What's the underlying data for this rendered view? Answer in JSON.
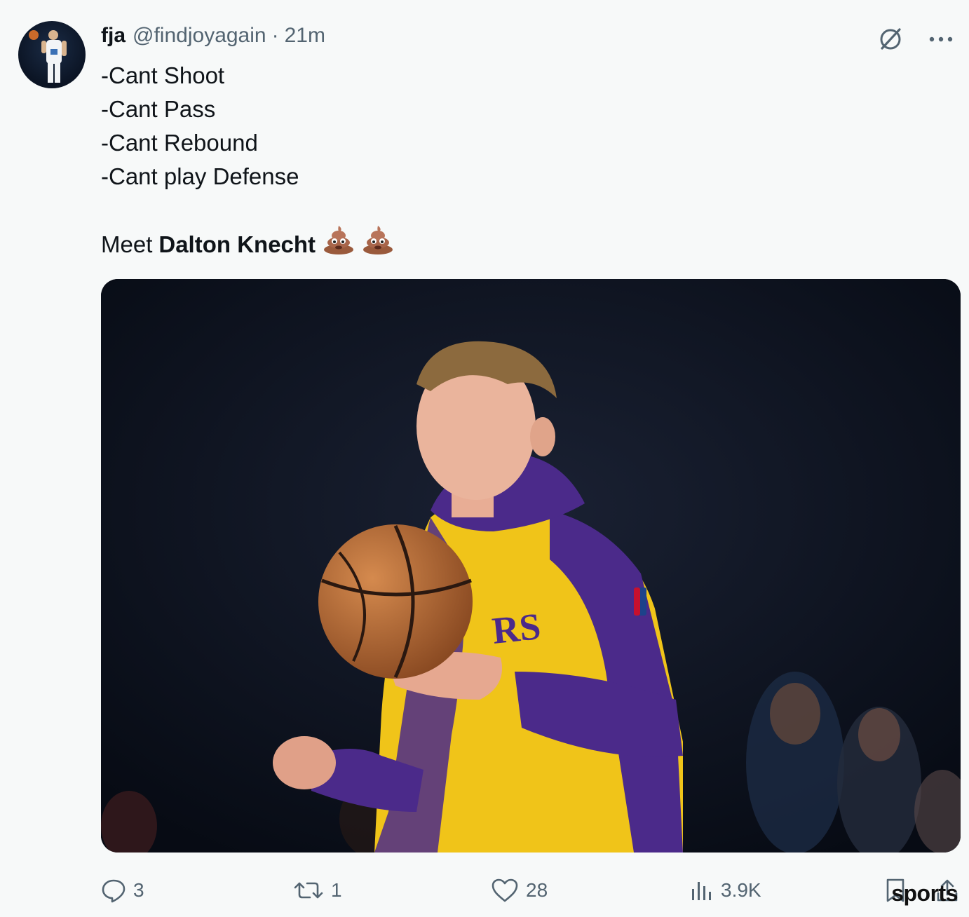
{
  "tweet": {
    "author_name": "fja",
    "handle": "@findjoyagain",
    "separator": "·",
    "time": "21m",
    "lines": [
      "-Cant Shoot",
      "-Cant Pass",
      "-Cant Rebound",
      "-Cant play Defense"
    ],
    "meet_prefix": "Meet",
    "meet_name": "Dalton Knecht",
    "emojis": [
      "pile-of-poo",
      "pile-of-poo"
    ]
  },
  "top_actions": {
    "grok_icon": "slashed-circle-icon",
    "more_icon": "more-icon"
  },
  "actions": {
    "replies": "3",
    "retweets": "1",
    "likes": "28",
    "views": "3.9K"
  },
  "watermark": "sports",
  "colors": {
    "text": "#0f1419",
    "muted": "#536471",
    "background": "#f7f9f9",
    "jersey_gold": "#f5c518",
    "jersey_purple": "#4b2a8a"
  }
}
